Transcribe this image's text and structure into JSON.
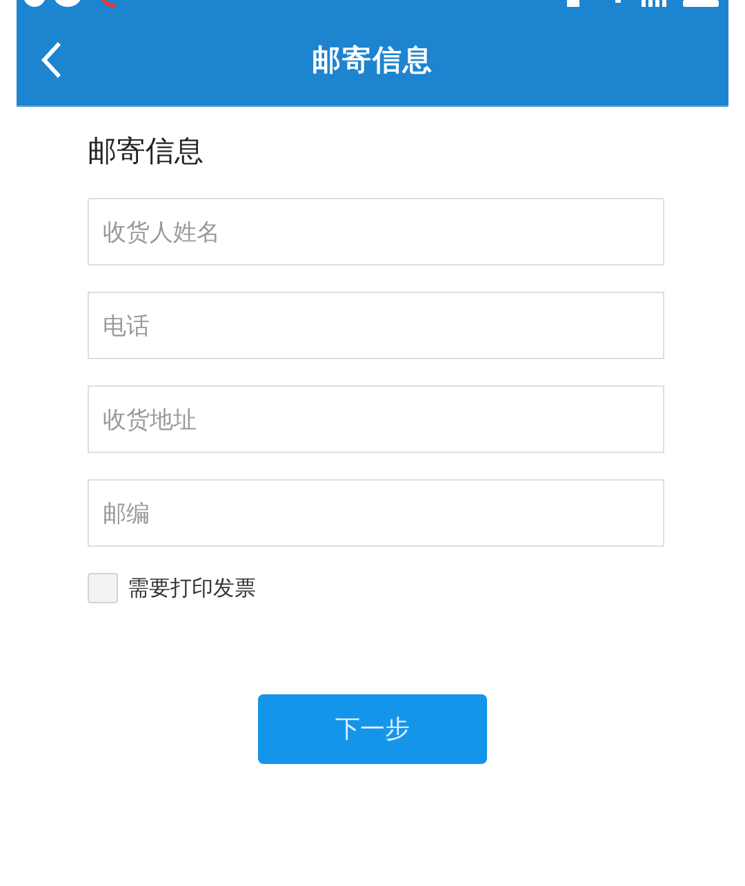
{
  "header": {
    "title": "邮寄信息"
  },
  "form": {
    "heading": "邮寄信息",
    "fields": [
      {
        "placeholder": "收货人姓名"
      },
      {
        "placeholder": "电话"
      },
      {
        "placeholder": "收货地址"
      },
      {
        "placeholder": "邮编"
      }
    ],
    "invoice": {
      "label": "需要打印发票",
      "checked": false
    },
    "submit": "下一步"
  }
}
